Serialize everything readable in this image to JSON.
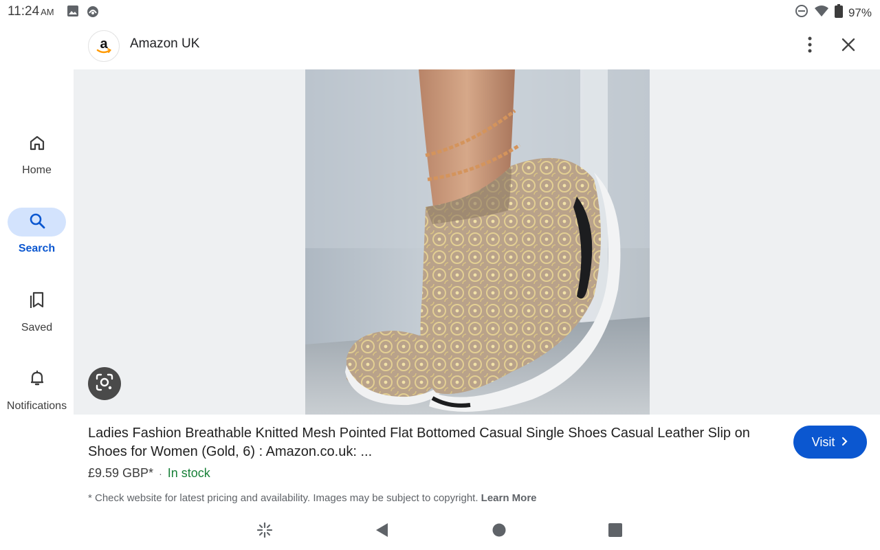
{
  "status": {
    "time": "11:24",
    "ampm": "AM",
    "battery": "97%",
    "icons": [
      "image-icon",
      "vpn-icon",
      "do-not-disturb-icon",
      "wifi-icon",
      "battery-icon"
    ]
  },
  "appbar": {
    "site_title": "Amazon UK",
    "logo_letter": "a",
    "more_icon": "more-vert-icon",
    "close_icon": "close-icon"
  },
  "nav": {
    "items": [
      {
        "label": "Home",
        "icon": "home-icon",
        "active": false
      },
      {
        "label": "Search",
        "icon": "search-icon",
        "active": true
      },
      {
        "label": "Saved",
        "icon": "bookmark-icon",
        "active": false
      },
      {
        "label": "Notifications",
        "icon": "bell-icon",
        "active": false
      }
    ]
  },
  "product": {
    "title": "Ladies Fashion Breathable Knitted Mesh Pointed Flat Bottomed Casual Single Shoes Casual Leather Slip on Shoes for Women (Gold, 6) : Amazon.co.uk: ...",
    "price": "£9.59 GBP*",
    "separator": "·",
    "stock": "In stock",
    "visit_label": "Visit",
    "disclaimer": "* Check website for latest pricing and availability. Images may be subject to copyright.",
    "learn_more": "Learn More"
  },
  "colors": {
    "accent": "#0b57d0",
    "nav_active_bg": "#d3e3fd",
    "in_stock": "#188038",
    "image_bg": "#eef0f2"
  }
}
